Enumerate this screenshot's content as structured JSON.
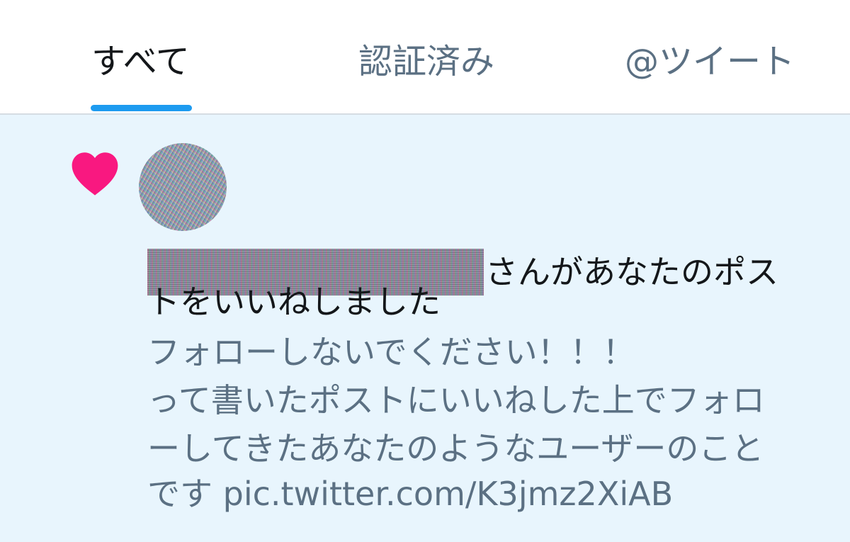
{
  "tabs": [
    {
      "label": "すべて",
      "active": true
    },
    {
      "label": "認証済み",
      "active": false
    },
    {
      "label": "@ツイート",
      "active": false
    }
  ],
  "colors": {
    "accent": "#1d9bf0",
    "heart": "#f91880",
    "notification_bg": "#e8f5fd",
    "primary_text": "#14171a",
    "secondary_text": "#5b7083"
  },
  "notification": {
    "icon": "heart-icon",
    "action_text_line1": "さんがあなたのポス",
    "action_text_line2": "トをいいねしました",
    "post_lines": [
      "フォローしないでください！！！",
      "って書いたポストにいいねした上でフォロ",
      "ーしてきたあなたのようなユーザーのこと"
    ],
    "post_last_prefix": "です ",
    "post_link": "pic.twitter.com/K3jmz2XiAB"
  }
}
